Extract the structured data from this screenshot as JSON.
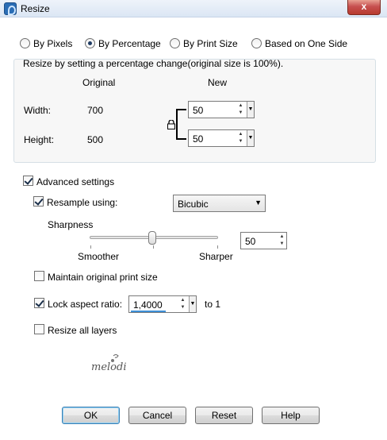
{
  "window": {
    "title": "Resize",
    "close_label": "x"
  },
  "mode": {
    "options": [
      "By Pixels",
      "By Percentage",
      "By Print Size",
      "Based on One Side"
    ],
    "selected": "By Percentage"
  },
  "group": {
    "description": "Resize by setting a percentage change(original size is 100%).",
    "col_original": "Original",
    "col_new": "New",
    "width_label": "Width:",
    "width_original": "700",
    "width_new": "50",
    "height_label": "Height:",
    "height_original": "500",
    "height_new": "50"
  },
  "advanced": {
    "label": "Advanced settings",
    "checked": true,
    "resample_label": "Resample using:",
    "resample_checked": true,
    "resample_value": "Bicubic",
    "sharpness_label": "Sharpness",
    "sharpness_value": "50",
    "smoother_label": "Smoother",
    "sharper_label": "Sharper",
    "maintain_label": "Maintain original print size",
    "maintain_checked": false,
    "lock_label": "Lock aspect ratio:",
    "lock_checked": true,
    "lock_value": "1,4000",
    "lock_suffix": "to 1",
    "resize_layers_label": "Resize all layers",
    "resize_layers_checked": false
  },
  "logo_text": "melodi",
  "buttons": {
    "ok": "OK",
    "cancel": "Cancel",
    "reset": "Reset",
    "help": "Help"
  }
}
